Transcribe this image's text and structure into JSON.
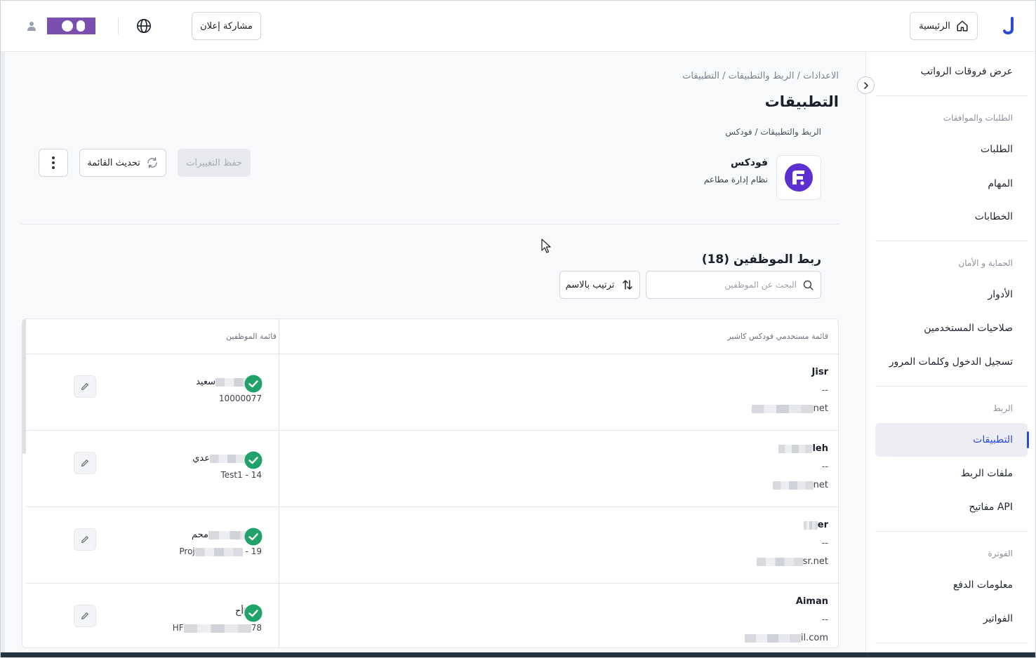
{
  "header": {
    "home_label": "الرئيسية",
    "share_label": "مشاركة إعلان"
  },
  "colors": {
    "accent": "#2a4bd7",
    "brand_purple": "#7b4fb0",
    "foodics_purple": "#5b2fd0",
    "success_green": "#1fa36b"
  },
  "sidebar": {
    "items_top": [
      {
        "label": "عرض فروقات الرواتب"
      }
    ],
    "sections": [
      {
        "title": "الطلبات والموافقات",
        "items": [
          "الطلبات",
          "المهام",
          "الخطابات"
        ]
      },
      {
        "title": "الحماية و الأمان",
        "items": [
          "الأدوار",
          "صلاحيات المستخدمين",
          "تسجيل الدخول وكلمات المرور"
        ]
      },
      {
        "title": "الربط",
        "items": [
          "التطبيقات",
          "ملفات الربط",
          "مفاتيح API"
        ]
      },
      {
        "title": "الفوترة",
        "items": [
          "معلومات الدفع",
          "الفواتير"
        ]
      }
    ],
    "active_item": "التطبيقات"
  },
  "main": {
    "breadcrumb": "الاعدادات / الربط والتطبيقات / التطبيقات",
    "title": "التطبيقات",
    "sub_breadcrumb": "الربط والتطبيقات / فودكس",
    "app": {
      "name": "فودكس",
      "description": "نظام إدارة مطاعم"
    },
    "actions": {
      "save_label": "حفظ التغييرات",
      "refresh_label": "تحديث القائمة"
    },
    "section_title": "ربط الموظفين (18)",
    "search": {
      "placeholder": "البحث عن الموظفين",
      "value": ""
    },
    "sort_label": "ترتيب بالاسم",
    "table": {
      "col_foodics": "قائمة مستخدمي فودكس كاشير",
      "col_employees": "قائمة الموظفين",
      "rows": [
        {
          "foodics_name": "Jisr",
          "dash": "--",
          "email_suffix": "net",
          "emp_name": "سعيد",
          "emp_id": "10000077"
        },
        {
          "foodics_name": "leh",
          "dash": "--",
          "email_suffix": "net",
          "emp_name_start": "خا",
          "emp_name_end": "عدي",
          "emp_id": "Test1 - 14"
        },
        {
          "foodics_name": "er",
          "dash": "--",
          "email_suffix": "sr.net",
          "emp_name": "محم",
          "emp_id_start": "Proj",
          "emp_id_end": " - 19"
        },
        {
          "foodics_name": "Aiman",
          "dash": "--",
          "email_suffix": "il.com",
          "emp_name": "أح",
          "emp_id_start": "HF",
          "emp_id_end": "78"
        }
      ]
    }
  }
}
